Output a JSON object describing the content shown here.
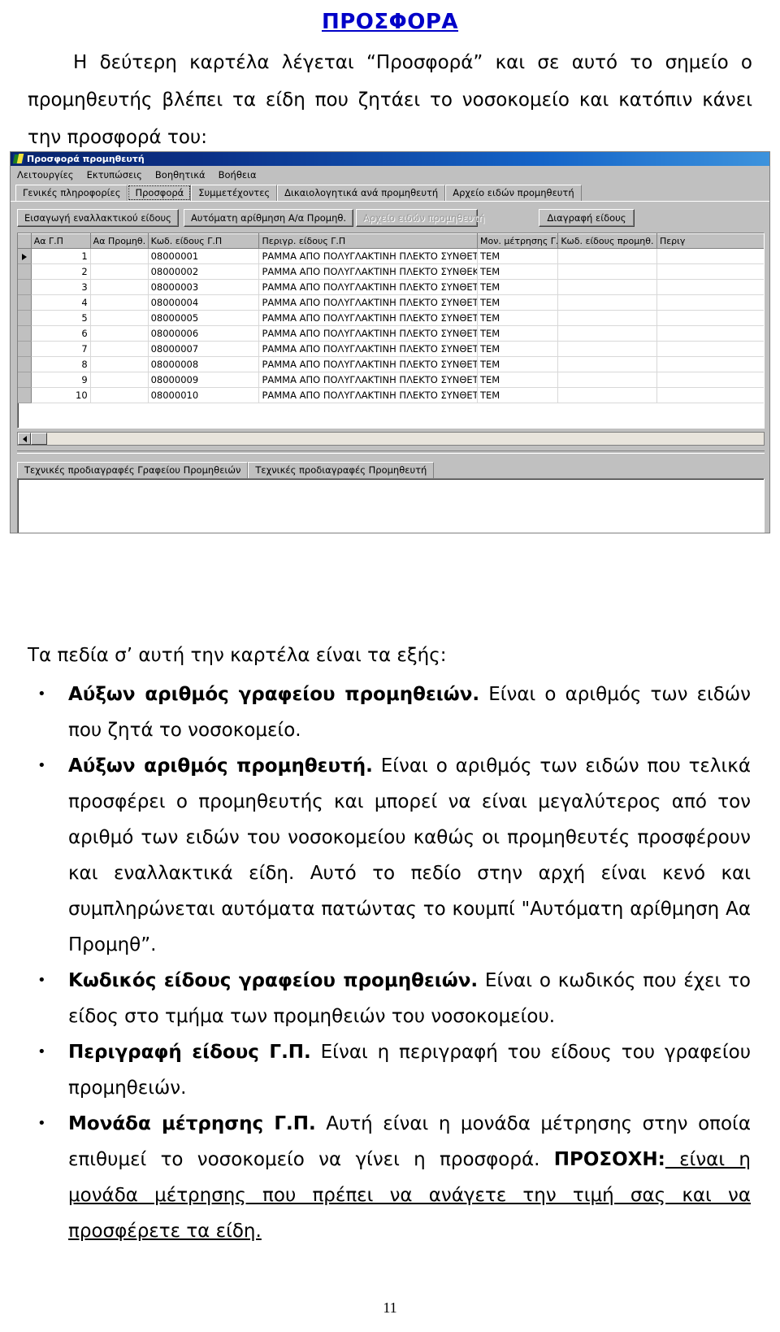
{
  "document": {
    "title": "ΠΡΟΣΦΟΡΑ",
    "intro_paragraph": "Η δεύτερη καρτέλα λέγεται “Προσφορά”  και σε αυτό το σημείο ο προμηθευτής βλέπει τα είδη που ζητάει το νοσοκομείο και κατόπιν κάνει την προσφορά του:",
    "lead_text": "Τα πεδία σ’ αυτή την καρτέλα είναι τα εξής:",
    "page_number": "11"
  },
  "app": {
    "title": "Προσφορά προμηθευτή",
    "menu": [
      {
        "label": "Λειτουργίες"
      },
      {
        "label": "Εκτυπώσεις"
      },
      {
        "label": "Βοηθητικά"
      },
      {
        "label": "Βοήθεια"
      }
    ],
    "tabs": [
      {
        "label": "Γενικές πληροφορίες",
        "active": false
      },
      {
        "label": "Προσφορά",
        "active": true
      },
      {
        "label": "Συμμετέχοντες",
        "active": false
      },
      {
        "label": "Δικαιολογητικά ανά προμηθευτή",
        "active": false
      },
      {
        "label": "Αρχείο ειδών προμηθευτή",
        "active": false
      }
    ],
    "toolbar": {
      "insert_alternative_label": "Εισαγωγή εναλλακτικού είδους",
      "auto_number_label": "Αυτόματη αρίθμηση Α/α Προμηθ.",
      "supplier_items_archive_label": "Αρχείο ειδών προμηθευτή",
      "delete_item_label": "Διαγραφή είδους"
    },
    "grid": {
      "columns": [
        "Αα Γ.Π",
        "Αα Προμηθ.",
        "Κωδ. είδους Γ.Π",
        "Περιγρ. είδους Γ.Π",
        "Μον. μέτρησης Γ.Π",
        "Κωδ. είδους προμηθ.",
        "Περιγ"
      ],
      "rows": [
        {
          "aa_gp": "1",
          "aa_prom": "",
          "kod_gp": "08000001",
          "perig_gp": "ΡΑΜΜΑ   ΑΠΟ ΠΟΛΥΓΛΑΚΤΙΝΗ ΠΛΕΚΤΟ ΣΥΝΘΕΤΙΚΟ ΑΠΟΡΡΟΦΗ ΣΙΜΟ ΑΠΛ",
          "monada_gp": "ΤΕΜ",
          "kod_prom": "",
          "perig_prom": ""
        },
        {
          "aa_gp": "2",
          "aa_prom": "",
          "kod_gp": "08000002",
          "perig_gp": "ΡΑΜΜΑ ΑΠΟ ΠΟΛΥΓΛΑΚΤΙΝΗ ΠΛΕΚΤΟ ΣΥΝΘΕΚΤΙΚΟ ΑΠΟΡΡΟΦΗ  ΣΙΜΟ",
          "monada_gp": "ΤΕΜ",
          "kod_prom": "",
          "perig_prom": ""
        },
        {
          "aa_gp": "3",
          "aa_prom": "",
          "kod_gp": "08000003",
          "perig_gp": "ΡΑΜΜΑ ΑΠΟ ΠΟΛΥΓΛΑΚΤΙΝΗ ΠΛΕΚΤΟ ΣΥΝΘΕΤΙΚΟ ΑΠΟΡΡΟΦΗΣΙ ΜΟ        Α",
          "monada_gp": "ΤΕΜ",
          "kod_prom": "",
          "perig_prom": ""
        },
        {
          "aa_gp": "4",
          "aa_prom": "",
          "kod_gp": "08000004",
          "perig_gp": "ΡΑΜΜΑ ΑΠΟ ΠΟΛΥΓΛΑΚΤΙΝΗ ΠΛΕΚΤΟ ΣΥΝΘΕΤΙΚΟ ΑΠΟΡΡΟΦΗΣΙ ΜΟ      Α",
          "monada_gp": "ΤΕΜ",
          "kod_prom": "",
          "perig_prom": ""
        },
        {
          "aa_gp": "5",
          "aa_prom": "",
          "kod_gp": "08000005",
          "perig_gp": "ΡΑΜΜΑ ΑΠΟ ΠΟΛΥΓΛΑΚΤΙΝΗ ΠΛΕΚΤΟ ΣΥΝΘΕΤΙΚΟ ΑΠΟΡΡΟΦΗΣΙ ΜΟ      Α",
          "monada_gp": "ΤΕΜ",
          "kod_prom": "",
          "perig_prom": ""
        },
        {
          "aa_gp": "6",
          "aa_prom": "",
          "kod_gp": "08000006",
          "perig_gp": "ΡΑΜΜΑ ΑΠΟ ΠΟΛΥΓΛΑΚΤΙΝΗ ΠΛΕΚΤΟ ΣΥΝΘΕΤΙΚΟ ΑΠΑΡΡΟΦΗΣΙ ΜΟ      Α",
          "monada_gp": "ΤΕΜ",
          "kod_prom": "",
          "perig_prom": ""
        },
        {
          "aa_gp": "7",
          "aa_prom": "",
          "kod_gp": "08000007",
          "perig_gp": "ΡΑΜΜΑ ΑΠΟ ΠΟΛΥΓΛΑΚΤΙΝΗ ΠΛΕΚΤΟ ΣΥΝΘΕΤΙΚΟ ΑΠΟΡΡΟΦΗΣΙ ΜΟ      Α",
          "monada_gp": "ΤΕΜ",
          "kod_prom": "",
          "perig_prom": ""
        },
        {
          "aa_gp": "8",
          "aa_prom": "",
          "kod_gp": "08000008",
          "perig_gp": "ΡΑΜΜΑ ΑΠΟ ΠΟΛΥΓΛΑΚΤΙΝΗ ΠΛΕΚΤΟ ΣΥΝΘΕΤΙΚΟ ΑΠΟΡΡΟΦΗΣΙ ΜΟ      Α",
          "monada_gp": "ΤΕΜ",
          "kod_prom": "",
          "perig_prom": ""
        },
        {
          "aa_gp": "9",
          "aa_prom": "",
          "kod_gp": "08000009",
          "perig_gp": "ΡΑΜΜΑ ΑΠΟ ΠΟΛΥΓΛΑΚΤΙΝΗ  ΠΛΕΚΤΟ ΣΥΝΘΕΤΙΚΟ ΑΠΟΡΡΟΦΗ  ΣΙΜΟ      ,",
          "monada_gp": "ΤΕΜ",
          "kod_prom": "",
          "perig_prom": ""
        },
        {
          "aa_gp": "10",
          "aa_prom": "",
          "kod_gp": "08000010",
          "perig_gp": "ΡΑΜΜΑ ΑΠΟ ΠΟΛΥΓΛΑΚΤΙΝΗ ΠΛΕΚΤΟ ΣΥΝΘΕΤΙΚΟ ΑΠΟΡΡΟΦΗΣΙ ΜΟ      Α",
          "monada_gp": "ΤΕΜ",
          "kod_prom": "",
          "perig_prom": ""
        }
      ]
    },
    "bottom_tabs": [
      {
        "label": "Τεχνικές προδιαγραφές Γραφείου Προμηθειών",
        "active": true
      },
      {
        "label": "Τεχνικές προδιαγραφές Προμηθευτή",
        "active": false
      }
    ]
  },
  "fields": [
    {
      "name": "Αύξων αριθμός γραφείου προμηθειών.",
      "desc": " Είναι ο αριθμός των ειδών που ζητά το νοσοκομείο."
    },
    {
      "name": "Αύξων αριθμός προμηθευτή.",
      "desc": " Είναι ο αριθμός των ειδών που τελικά προσφέρει ο προμηθευτής και μπορεί να είναι μεγαλύτερος από τον αριθμό των ειδών του νοσοκομείου καθώς οι προμηθευτές προσφέρουν και εναλλακτικά είδη. Αυτό το πεδίο στην αρχή είναι κενό και συμπληρώνεται αυτόματα πατώντας το κουμπί  \"Αυτόματη αρίθμηση Αα Προμηθ”."
    },
    {
      "name": "Κωδικός είδους γραφείου προμηθειών.",
      "desc": " Είναι ο κωδικός που έχει το είδος στο τμήμα των προμηθειών του νοσοκομείου."
    },
    {
      "name": "Περιγραφή είδους Γ.Π.",
      "desc": " Είναι η περιγραφή του είδους του γραφείου προμηθειών."
    },
    {
      "name": "Μονάδα μέτρησης Γ.Π.",
      "desc": " Αυτή είναι η μονάδα μέτρησης στην οποία επιθυμεί το νοσοκομείο να γίνει η προσφορά. ",
      "attention_label": "ΠΡΟΣΟΧΗ:",
      "attention_text": " είναι η μονάδα μέτρησης που πρέπει να ανάγετε την τιμή σας και να προσφέρετε τα είδη."
    }
  ]
}
